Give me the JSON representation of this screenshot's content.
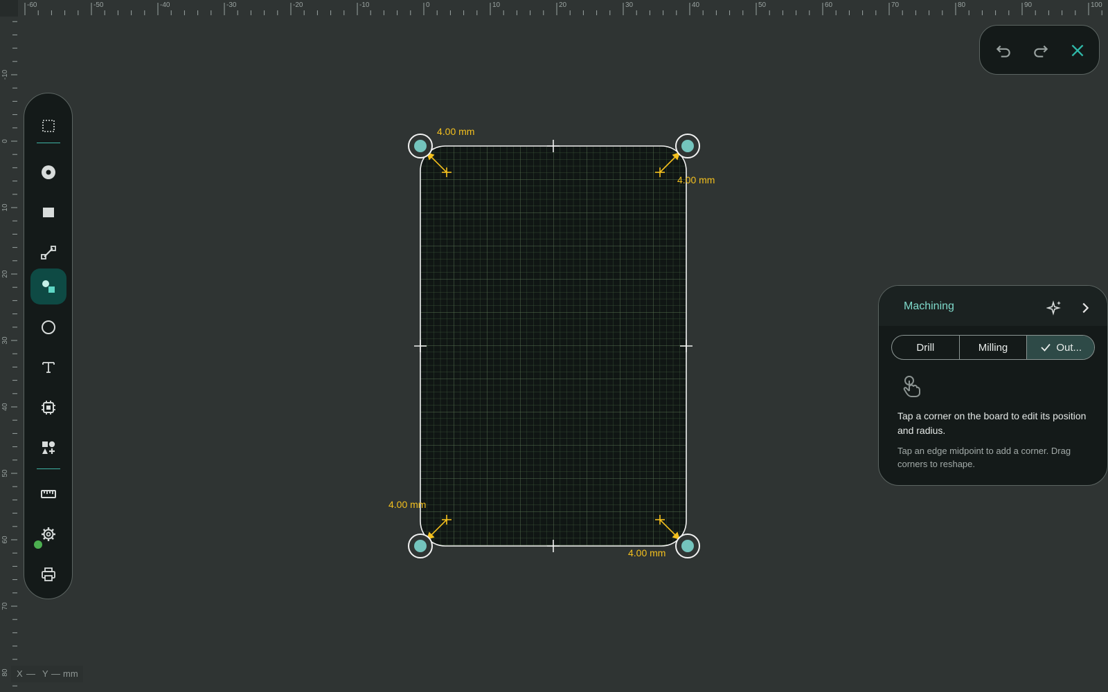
{
  "rulers": {
    "top_labels": [
      "-60",
      "-50",
      "-40",
      "-30",
      "-20",
      "-10",
      "0",
      "10",
      "20",
      "30",
      "40",
      "50",
      "60",
      "70",
      "80",
      "90",
      "100"
    ],
    "left_labels": [
      "-10",
      "0",
      "10",
      "20",
      "30",
      "40",
      "50",
      "60",
      "70",
      "80"
    ]
  },
  "toolbar": {
    "tools": [
      {
        "icon": "select-icon",
        "active": false
      },
      {
        "icon": "drill-icon",
        "active": false
      },
      {
        "icon": "pad-icon",
        "active": false
      },
      {
        "icon": "trace-icon",
        "active": false
      },
      {
        "icon": "shapes-icon",
        "active": true
      },
      {
        "icon": "circle-icon",
        "active": false
      },
      {
        "icon": "text-icon",
        "active": false
      },
      {
        "icon": "chip-icon",
        "active": false
      },
      {
        "icon": "add-shapes-icon",
        "active": false
      },
      {
        "icon": "ruler-icon",
        "active": false
      },
      {
        "icon": "gear-icon",
        "active": false
      },
      {
        "icon": "printer-icon",
        "active": false
      }
    ],
    "status_color": "#4caf50"
  },
  "history": {
    "icons": [
      "undo-icon",
      "redo-icon",
      "close-icon"
    ],
    "close_color": "#2fb8a8"
  },
  "board": {
    "corner_labels": [
      "4.00 mm",
      "4.00 mm",
      "4.00 mm",
      "4.00 mm"
    ],
    "accent_color": "#f4c01e",
    "handle_color": "#74c4bd"
  },
  "machining": {
    "title": "Machining",
    "tabs": [
      {
        "label": "Drill",
        "selected": false
      },
      {
        "label": "Milling",
        "selected": false
      },
      {
        "label": "Out...",
        "selected": true
      }
    ],
    "hint_main": "Tap a corner on the board to edit its position and radius.",
    "hint_sub": "Tap an edge midpoint to add a corner. Drag corners to reshape."
  },
  "coords": {
    "x_label": "X",
    "x_value": "—",
    "y_label": "Y",
    "y_value": "—",
    "unit": "mm"
  }
}
